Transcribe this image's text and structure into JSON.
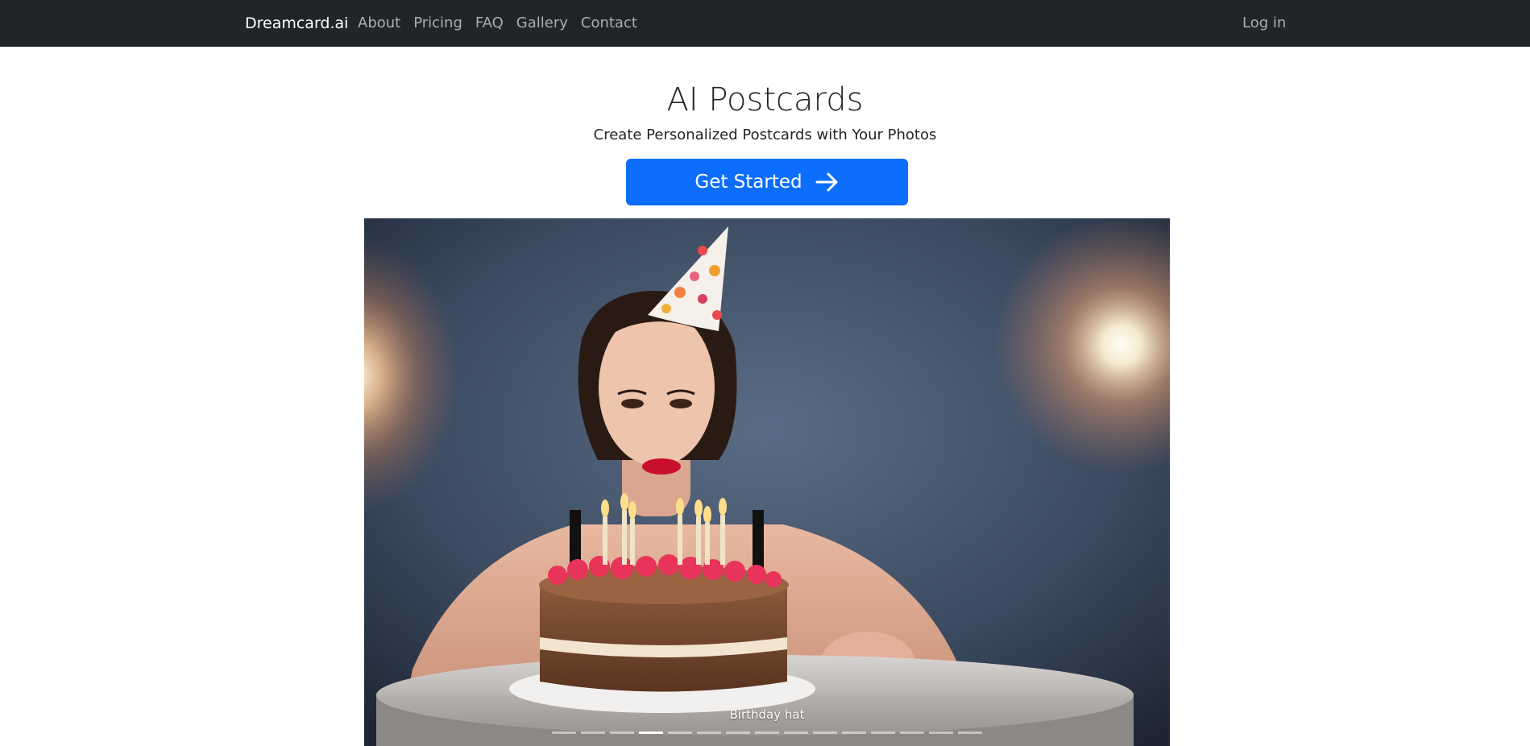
{
  "navbar": {
    "brand": "Dreamcard.ai",
    "links": [
      {
        "label": "About"
      },
      {
        "label": "Pricing"
      },
      {
        "label": "FAQ"
      },
      {
        "label": "Gallery"
      },
      {
        "label": "Contact"
      }
    ],
    "login_label": "Log in"
  },
  "hero": {
    "title": "AI Postcards",
    "subtitle": "Create Personalized Postcards with Your Photos",
    "cta_label": "Get Started",
    "cta_icon": "arrow-right-icon"
  },
  "carousel": {
    "caption": "Birthday hat",
    "indicator_count": 15,
    "active_index": 3
  },
  "colors": {
    "navbar_bg": "#212529",
    "primary": "#0d6efd"
  }
}
